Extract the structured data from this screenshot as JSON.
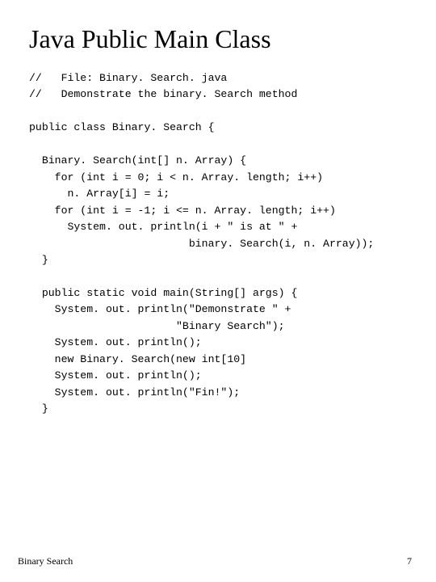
{
  "title": "Java Public Main Class",
  "code": {
    "l1": "//   File: Binary. Search. java",
    "l2": "//   Demonstrate the binary. Search method",
    "l3": "",
    "l4": "public class Binary. Search {",
    "l5": "",
    "l6": "  Binary. Search(int[] n. Array) {",
    "l7": "    for (int i = 0; i < n. Array. length; i++)",
    "l8": "      n. Array[i] = i;",
    "l9": "    for (int i = -1; i <= n. Array. length; i++)",
    "l10": "      System. out. println(i + \" is at \" +",
    "l11": "                         binary. Search(i, n. Array));",
    "l12": "  }",
    "l13": "",
    "l14": "  public static void main(String[] args) {",
    "l15": "    System. out. println(\"Demonstrate \" +",
    "l16": "                       \"Binary Search\");",
    "l17": "    System. out. println();",
    "l18": "    new Binary. Search(new int[10]",
    "l19": "    System. out. println();",
    "l20": "    System. out. println(\"Fin!\");",
    "l21": "  }"
  },
  "footer": {
    "left": "Binary Search",
    "right": "7"
  }
}
